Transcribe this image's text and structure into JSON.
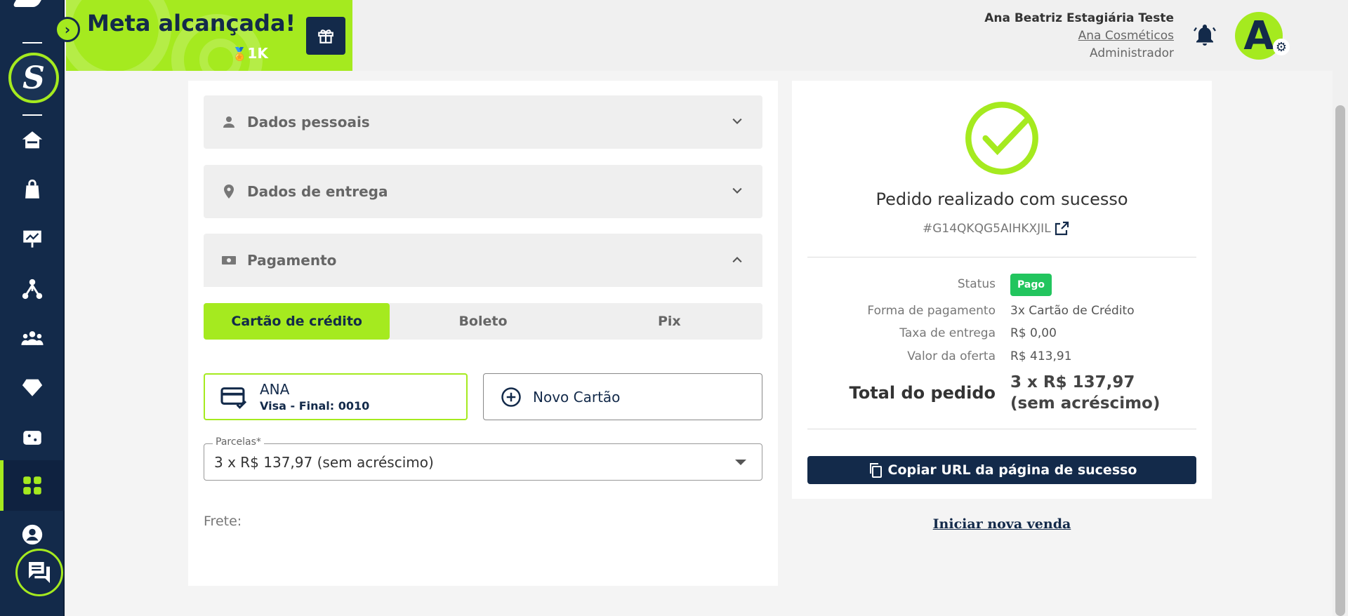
{
  "banner": {
    "title": "Meta alcançada!",
    "points": "1K"
  },
  "user": {
    "name": "Ana Beatriz Estagiária Teste",
    "company": "Ana Cosméticos",
    "role": "Administrador",
    "avatar_letter": "A"
  },
  "accordions": [
    {
      "label": "Dados pessoais",
      "icon": "person-icon",
      "expanded": false
    },
    {
      "label": "Dados de entrega",
      "icon": "location-icon",
      "expanded": false
    },
    {
      "label": "Pagamento",
      "icon": "cash-icon",
      "expanded": true
    }
  ],
  "payment": {
    "tabs": [
      "Cartão de crédito",
      "Boleto",
      "Pix"
    ],
    "active_tab": "Cartão de crédito",
    "saved_card": {
      "holder": "ANA",
      "detail": "Visa - Final: 0010"
    },
    "new_card_label": "Novo Cartão",
    "installments_label": "Parcelas*",
    "installments_value": "3 x R$ 137,97 (sem acréscimo)",
    "freight_label": "Frete:"
  },
  "summary": {
    "title": "Pedido realizado com sucesso",
    "order_id": "#G14QKQG5AIHKXJIL",
    "status_label": "Status",
    "status_value": "Pago",
    "payment_method_label": "Forma de pagamento",
    "payment_method_value": "3x Cartão de Crédito",
    "delivery_fee_label": "Taxa de entrega",
    "delivery_fee_value": "R$ 0,00",
    "offer_value_label": "Valor da oferta",
    "offer_value_value": "R$ 413,91",
    "total_label": "Total do pedido",
    "total_value": "3 x R$ 137,97 (sem acréscimo)",
    "copy_button": "Copiar URL da página de sucesso",
    "new_sale_link": "Iniciar nova venda"
  },
  "colors": {
    "accent": "#a5ea1f",
    "navy": "#132a4a",
    "success": "#22c55e"
  }
}
